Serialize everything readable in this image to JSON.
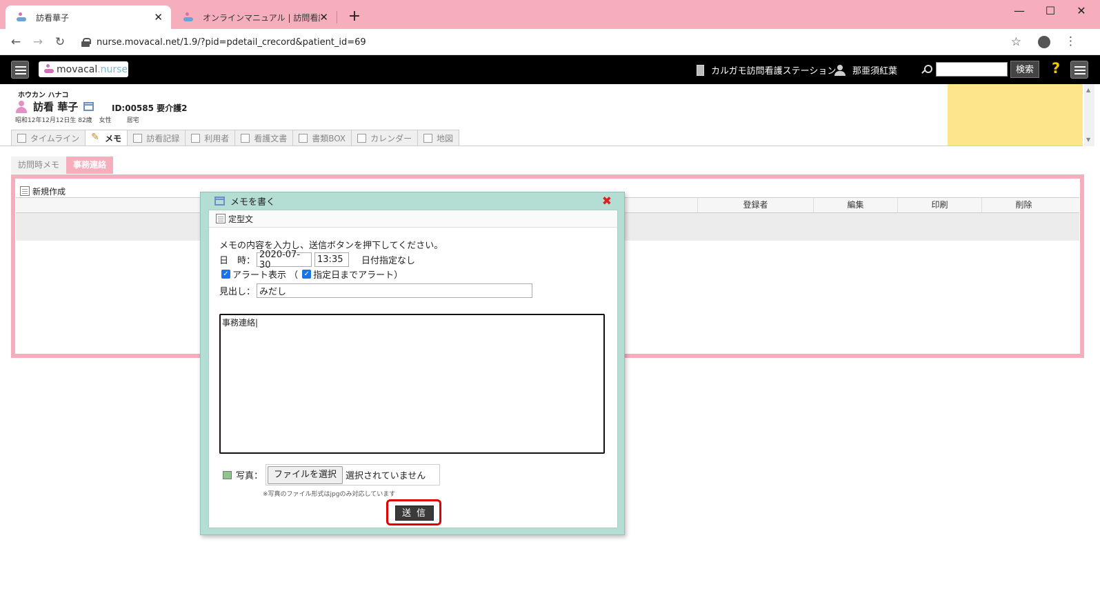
{
  "browser": {
    "tabs": [
      {
        "title": "訪看華子",
        "active": true
      },
      {
        "title": "オンラインマニュアル | 訪問看護対応",
        "active": false
      }
    ],
    "new_tab": "+",
    "url": "nurse.movacal.net/1.9/?pid=pdetail_crecord&patient_id=69",
    "window_controls": {
      "minimize": "—",
      "maximize": "☐",
      "close": "✕"
    }
  },
  "app": {
    "logo_main": "movacal",
    "logo_sub": ".nurse",
    "station": "カルガモ訪問看護ステーション",
    "user": "那亜須紅葉",
    "search_button": "検索",
    "help": "?"
  },
  "patient": {
    "kana": "ホウカン ハナコ",
    "name": "訪看 華子",
    "id_care": "ID:00585 要介護2",
    "birth": "昭和12年12月12日生 82歳",
    "gender": "女性",
    "residence": "居宅"
  },
  "tabs": [
    "タイムライン",
    "メモ",
    "訪看記録",
    "利用者",
    "看護文書",
    "書類BOX",
    "カレンダー",
    "地図"
  ],
  "subtabs": [
    "訪問時メモ",
    "事務連絡"
  ],
  "list": {
    "new_button": "新規作成",
    "columns": [
      "登録者",
      "編集",
      "印刷",
      "削除"
    ]
  },
  "modal": {
    "title": "メモを書く",
    "template_label": "定型文",
    "intro": "メモの内容を入力し、送信ボタンを押下してください。",
    "date_label": "日　時：",
    "date_value": "2020-07-30",
    "time_value": "13:35",
    "date_unset": "日付指定なし",
    "alert_label": "アラート表示 （",
    "alert_until_label": "指定日までアラート）",
    "heading_label": "見出し：",
    "heading_value": "みだし",
    "body_value": "事務連絡|",
    "photo_label": "写真：",
    "file_button": "ファイルを選択",
    "file_status": "選択されていません",
    "photo_note": "※写真のファイル形式はjpgのみ対応しています",
    "send_button": "送信"
  },
  "colors": {
    "accent_pink": "#f6aebc",
    "modal_bg": "#b4ddd4",
    "highlight_red": "#e00000",
    "memo_yellow": "#fde58b"
  }
}
